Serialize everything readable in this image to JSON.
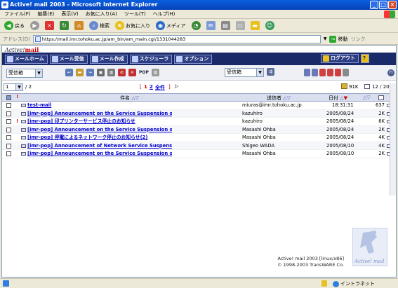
{
  "window": {
    "title": "Active! mail 2003 - Microsoft Internet Explorer"
  },
  "menu": [
    "ファイル(F)",
    "編集(E)",
    "表示(V)",
    "お気に入り(A)",
    "ツール(T)",
    "ヘルプ(H)"
  ],
  "toolbar": {
    "back": "戻る",
    "search": "検索",
    "favorites": "お気に入り",
    "media": "メディア"
  },
  "address": {
    "label": "アドレス(D)",
    "url": "https://mail.imr.tohoku.ac.jp/am_bin/am_main.cgi/1331044283",
    "go": "移動",
    "links": "リンク"
  },
  "app": {
    "logo": "Active!",
    "logo_accent": "mail"
  },
  "nav": {
    "home": "メールホーム",
    "receive": "メール受信",
    "compose": "メール作成",
    "schedule": "スケジューラ",
    "options": "オプション",
    "logout": "ログアウト",
    "help": "?"
  },
  "actions": {
    "folder_select": "受信箱",
    "move_select": "受信箱",
    "pop": "POP"
  },
  "paging": {
    "page_select": "1",
    "total_pages": "/ 2",
    "bracket_open": "[",
    "p1": "1",
    "p2": "2",
    "all": "全件",
    "bracket_close": "]",
    "quota": "91K",
    "count": "12 / 20"
  },
  "columns": {
    "subject": "件名",
    "from": "送信者",
    "date": "日付",
    "size": "サイズ"
  },
  "messages": [
    {
      "subject": "test-mail",
      "from": "miuras@imr.tohoku.ac.jp",
      "date": "18:31:31",
      "size": "637"
    },
    {
      "subject": "[imr-pop] Announcement on the Service Suspension o...",
      "from": "kazuhiro",
      "date": "2005/08/24",
      "size": "2K"
    },
    {
      "subject": "[imr-pop] 印プリンターサービス停止のお知らせ",
      "from": "kazuhiro",
      "date": "2005/08/24",
      "size": "6K"
    },
    {
      "subject": "[imr-pop] Announcement on the Service Suspension o...",
      "from": "Masashi Ohba",
      "date": "2005/08/24",
      "size": "2K"
    },
    {
      "subject": "[imr-pop] 停電によるネットワーク停止のお知らせ(2)",
      "from": "Masashi Ohba",
      "date": "2005/08/24",
      "size": "4K"
    },
    {
      "subject": "[imr-pop] Announcement of Network Service Suspensi...",
      "from": "Shigeo WADA",
      "date": "2005/08/10",
      "size": "4K"
    },
    {
      "subject": "[imr-pop] Announcement on the Service Suspension o...",
      "from": "Masashi Ohba",
      "date": "2005/08/10",
      "size": "2K"
    }
  ],
  "footer": {
    "line1": "Active! mail 2003 [linux/x86]",
    "line2": "© 1998-2003 TransWARE Co.",
    "badge": "Active! mail"
  },
  "status": {
    "zone": "イントラネット"
  }
}
